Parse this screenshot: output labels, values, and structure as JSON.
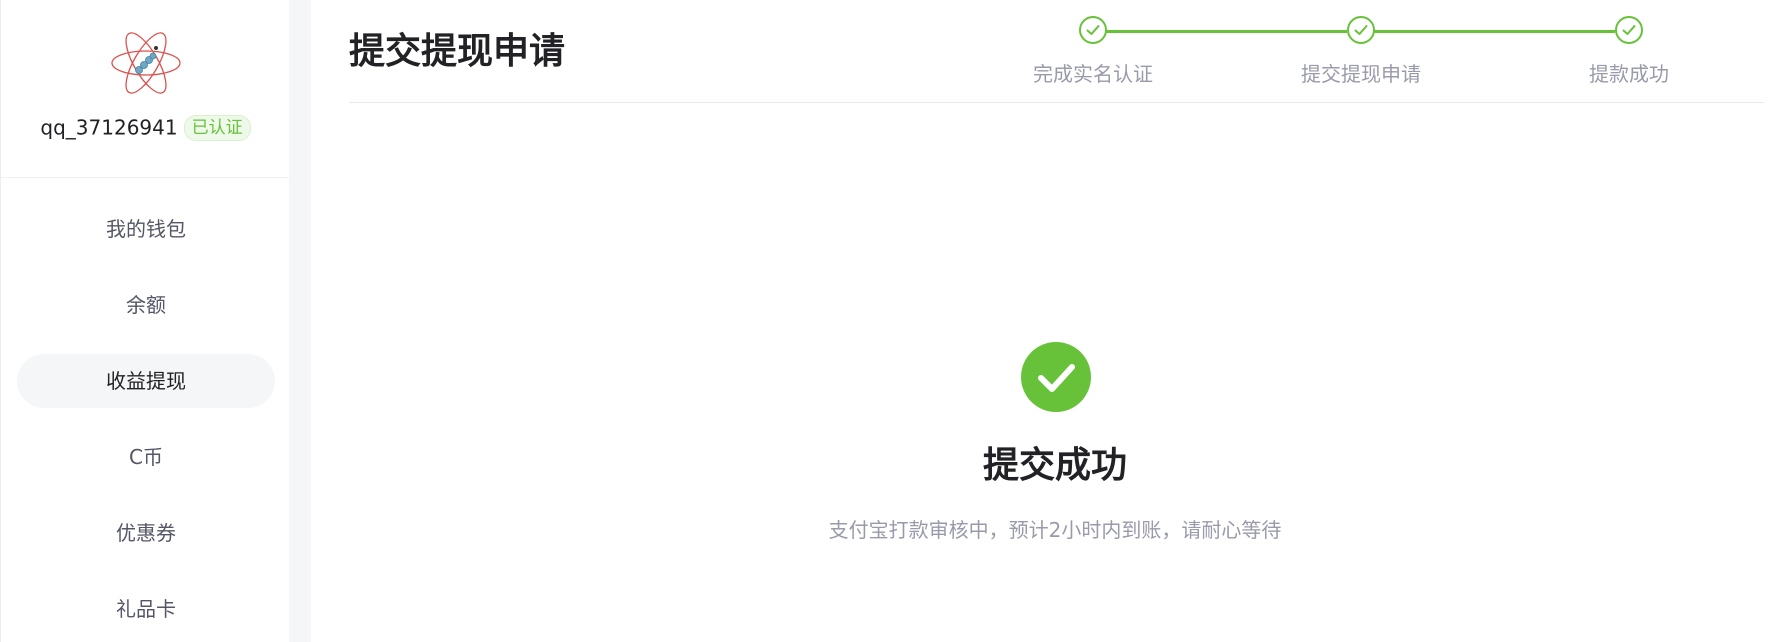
{
  "sidebar": {
    "username": "qq_37126941",
    "verified_badge": "已认证",
    "menu": [
      {
        "label": "我的钱包",
        "active": false
      },
      {
        "label": "余额",
        "active": false
      },
      {
        "label": "收益提现",
        "active": true
      },
      {
        "label": "C币",
        "active": false
      },
      {
        "label": "优惠券",
        "active": false
      },
      {
        "label": "礼品卡",
        "active": false
      }
    ]
  },
  "header": {
    "title": "提交提现申请",
    "steps": [
      {
        "label": "完成实名认证",
        "status": "done"
      },
      {
        "label": "提交提现申请",
        "status": "done"
      },
      {
        "label": "提款成功",
        "status": "done"
      }
    ]
  },
  "result": {
    "title": "提交成功",
    "description": "支付宝打款审核中，预计2小时内到账，请耐心等待",
    "icon": "check-circle-icon"
  },
  "colors": {
    "accent_green": "#67c23a",
    "text_dark": "#222226",
    "text_muted": "#999aaa"
  }
}
